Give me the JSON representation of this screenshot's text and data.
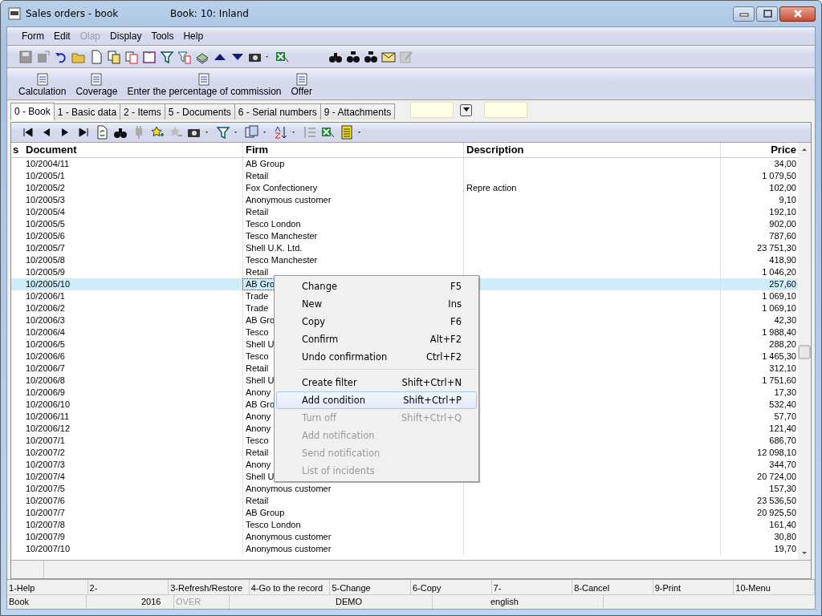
{
  "window": {
    "title": "Sales orders - book",
    "subtitle": "Book: 10: Inland"
  },
  "menu": [
    {
      "label": "Form",
      "disabled": false
    },
    {
      "label": "Edit",
      "disabled": false
    },
    {
      "label": "Olap",
      "disabled": true
    },
    {
      "label": "Display",
      "disabled": false
    },
    {
      "label": "Tools",
      "disabled": false
    },
    {
      "label": "Help",
      "disabled": false
    }
  ],
  "commands": [
    "Calculation",
    "Coverage",
    "Enter the percentage of commission",
    "Offer"
  ],
  "tabs": [
    {
      "label": "0 - Book",
      "selected": true
    },
    {
      "label": "1 - Basic data",
      "selected": false
    },
    {
      "label": "2 - Items",
      "selected": false
    },
    {
      "label": "5 - Documents",
      "selected": false
    },
    {
      "label": "6 - Serial numbers",
      "selected": false
    },
    {
      "label": "9 - Attachments",
      "selected": false
    }
  ],
  "table": {
    "columns": [
      "s",
      "Document",
      "Firm",
      "Description",
      "Price"
    ],
    "rows": [
      {
        "document": "10/2004/11",
        "firm": "AB Group",
        "price": "34,00",
        "selected": false
      },
      {
        "document": "10/2005/1",
        "firm": "Retail",
        "price": "1 079,50",
        "selected": false
      },
      {
        "document": "10/2005/2",
        "firm": "Fox Confectionery",
        "description": "Repre action",
        "price": "102,00",
        "selected": false
      },
      {
        "document": "10/2005/3",
        "firm": "Anonymous customer",
        "price": "9,10",
        "selected": false
      },
      {
        "document": "10/2005/4",
        "firm": "Retail",
        "price": "192,10",
        "selected": false
      },
      {
        "document": "10/2005/5",
        "firm": "Tesco London",
        "price": "902,00",
        "selected": false
      },
      {
        "document": "10/2005/6",
        "firm": "Tesco Manchester",
        "price": "787,60",
        "selected": false
      },
      {
        "document": "10/2005/7",
        "firm": "Shell U.K. Ltd.",
        "price": "23 751,30",
        "selected": false
      },
      {
        "document": "10/2005/8",
        "firm": "Tesco Manchester",
        "price": "418,90",
        "selected": false
      },
      {
        "document": "10/2005/9",
        "firm": "Retail",
        "price": "1 046,20",
        "selected": false
      },
      {
        "document": "10/2005/10",
        "firm": "AB Gro",
        "price": "257,60",
        "selected": true
      },
      {
        "document": "10/2006/1",
        "firm": "Trade",
        "price": "1 069,10",
        "selected": false
      },
      {
        "document": "10/2006/2",
        "firm": "Trade",
        "price": "1 069,10",
        "selected": false
      },
      {
        "document": "10/2006/3",
        "firm": "AB Gro",
        "price": "42,30",
        "selected": false
      },
      {
        "document": "10/2006/4",
        "firm": "Tesco",
        "price": "1 988,40",
        "selected": false
      },
      {
        "document": "10/2006/5",
        "firm": "Shell U",
        "price": "288,20",
        "selected": false
      },
      {
        "document": "10/2006/6",
        "firm": "Tesco",
        "price": "1 465,30",
        "selected": false
      },
      {
        "document": "10/2006/7",
        "firm": "Retail",
        "price": "312,10",
        "selected": false
      },
      {
        "document": "10/2006/8",
        "firm": "Shell U",
        "price": "1 751,60",
        "selected": false
      },
      {
        "document": "10/2006/9",
        "firm": "Anony",
        "price": "17,30",
        "selected": false
      },
      {
        "document": "10/2006/10",
        "firm": "AB Gro",
        "price": "532,40",
        "selected": false
      },
      {
        "document": "10/2006/11",
        "firm": "Anony",
        "price": "57,70",
        "selected": false
      },
      {
        "document": "10/2006/12",
        "firm": "Anony",
        "price": "121,40",
        "selected": false
      },
      {
        "document": "10/2007/1",
        "firm": "Tesco",
        "price": "686,70",
        "selected": false
      },
      {
        "document": "10/2007/2",
        "firm": "Retail",
        "price": "12 098,10",
        "selected": false
      },
      {
        "document": "10/2007/3",
        "firm": "Anony",
        "price": "344,70",
        "selected": false
      },
      {
        "document": "10/2007/4",
        "firm": "Shell U",
        "price": "20 724,00",
        "selected": false
      },
      {
        "document": "10/2007/5",
        "firm": "Anonymous customer",
        "price": "157,30",
        "selected": false
      },
      {
        "document": "10/2007/6",
        "firm": "Retail",
        "price": "23 536,50",
        "selected": false
      },
      {
        "document": "10/2007/7",
        "firm": "AB Group",
        "price": "20 925,50",
        "selected": false
      },
      {
        "document": "10/2007/8",
        "firm": "Tesco London",
        "price": "161,40",
        "selected": false
      },
      {
        "document": "10/2007/9",
        "firm": "Anonymous customer",
        "price": "30,80",
        "selected": false
      },
      {
        "document": "10/2007/10",
        "firm": "Anonymous customer",
        "price": "19,70",
        "selected": false
      }
    ]
  },
  "context_menu": {
    "groups": [
      [
        {
          "label": "Change",
          "shortcut": "F5",
          "disabled": false,
          "selected": false
        },
        {
          "label": "New",
          "shortcut": "Ins",
          "disabled": false,
          "selected": false
        },
        {
          "label": "Copy",
          "shortcut": "F6",
          "disabled": false,
          "selected": false
        },
        {
          "label": "Confirm",
          "shortcut": "Alt+F2",
          "disabled": false,
          "selected": false
        },
        {
          "label": "Undo confirmation",
          "shortcut": "Ctrl+F2",
          "disabled": false,
          "selected": false
        }
      ],
      [
        {
          "label": "Create filter",
          "shortcut": "Shift+Ctrl+N",
          "disabled": false,
          "selected": false
        },
        {
          "label": "Add condition",
          "shortcut": "Shift+Ctrl+P",
          "disabled": false,
          "selected": true
        },
        {
          "label": "Turn off",
          "shortcut": "Shift+Ctrl+Q",
          "disabled": true,
          "selected": false
        },
        {
          "label": "Add notification",
          "disabled": true,
          "selected": false
        },
        {
          "label": "Send notification",
          "disabled": true,
          "selected": false
        },
        {
          "label": "List of incidents",
          "disabled": true,
          "selected": false
        }
      ]
    ]
  },
  "function_keys": [
    "1-Help",
    "2-",
    "3-Refresh/Restore",
    "4-Go to the record",
    "5-Change",
    "6-Copy",
    "7-",
    "8-Cancel",
    "9-Print",
    "10-Menu"
  ],
  "status_bar": [
    {
      "text": "Book",
      "disabled": false
    },
    {
      "text": "2016",
      "disabled": false
    },
    {
      "text": "OVER",
      "disabled": true
    },
    {
      "text": "DEMO",
      "disabled": false
    },
    {
      "text": "english",
      "disabled": false
    }
  ]
}
